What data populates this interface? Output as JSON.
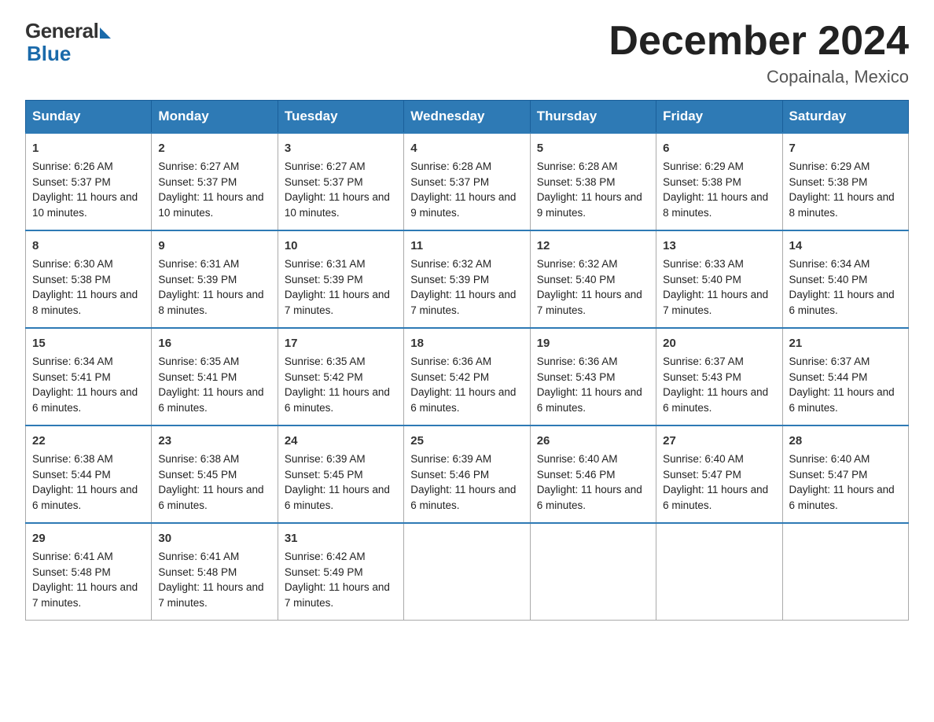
{
  "header": {
    "logo_general": "General",
    "logo_blue": "Blue",
    "month_title": "December 2024",
    "location": "Copainala, Mexico"
  },
  "days_of_week": [
    "Sunday",
    "Monday",
    "Tuesday",
    "Wednesday",
    "Thursday",
    "Friday",
    "Saturday"
  ],
  "weeks": [
    [
      {
        "day": "1",
        "sunrise": "6:26 AM",
        "sunset": "5:37 PM",
        "daylight": "11 hours and 10 minutes."
      },
      {
        "day": "2",
        "sunrise": "6:27 AM",
        "sunset": "5:37 PM",
        "daylight": "11 hours and 10 minutes."
      },
      {
        "day": "3",
        "sunrise": "6:27 AM",
        "sunset": "5:37 PM",
        "daylight": "11 hours and 10 minutes."
      },
      {
        "day": "4",
        "sunrise": "6:28 AM",
        "sunset": "5:37 PM",
        "daylight": "11 hours and 9 minutes."
      },
      {
        "day": "5",
        "sunrise": "6:28 AM",
        "sunset": "5:38 PM",
        "daylight": "11 hours and 9 minutes."
      },
      {
        "day": "6",
        "sunrise": "6:29 AM",
        "sunset": "5:38 PM",
        "daylight": "11 hours and 8 minutes."
      },
      {
        "day": "7",
        "sunrise": "6:29 AM",
        "sunset": "5:38 PM",
        "daylight": "11 hours and 8 minutes."
      }
    ],
    [
      {
        "day": "8",
        "sunrise": "6:30 AM",
        "sunset": "5:38 PM",
        "daylight": "11 hours and 8 minutes."
      },
      {
        "day": "9",
        "sunrise": "6:31 AM",
        "sunset": "5:39 PM",
        "daylight": "11 hours and 8 minutes."
      },
      {
        "day": "10",
        "sunrise": "6:31 AM",
        "sunset": "5:39 PM",
        "daylight": "11 hours and 7 minutes."
      },
      {
        "day": "11",
        "sunrise": "6:32 AM",
        "sunset": "5:39 PM",
        "daylight": "11 hours and 7 minutes."
      },
      {
        "day": "12",
        "sunrise": "6:32 AM",
        "sunset": "5:40 PM",
        "daylight": "11 hours and 7 minutes."
      },
      {
        "day": "13",
        "sunrise": "6:33 AM",
        "sunset": "5:40 PM",
        "daylight": "11 hours and 7 minutes."
      },
      {
        "day": "14",
        "sunrise": "6:34 AM",
        "sunset": "5:40 PM",
        "daylight": "11 hours and 6 minutes."
      }
    ],
    [
      {
        "day": "15",
        "sunrise": "6:34 AM",
        "sunset": "5:41 PM",
        "daylight": "11 hours and 6 minutes."
      },
      {
        "day": "16",
        "sunrise": "6:35 AM",
        "sunset": "5:41 PM",
        "daylight": "11 hours and 6 minutes."
      },
      {
        "day": "17",
        "sunrise": "6:35 AM",
        "sunset": "5:42 PM",
        "daylight": "11 hours and 6 minutes."
      },
      {
        "day": "18",
        "sunrise": "6:36 AM",
        "sunset": "5:42 PM",
        "daylight": "11 hours and 6 minutes."
      },
      {
        "day": "19",
        "sunrise": "6:36 AM",
        "sunset": "5:43 PM",
        "daylight": "11 hours and 6 minutes."
      },
      {
        "day": "20",
        "sunrise": "6:37 AM",
        "sunset": "5:43 PM",
        "daylight": "11 hours and 6 minutes."
      },
      {
        "day": "21",
        "sunrise": "6:37 AM",
        "sunset": "5:44 PM",
        "daylight": "11 hours and 6 minutes."
      }
    ],
    [
      {
        "day": "22",
        "sunrise": "6:38 AM",
        "sunset": "5:44 PM",
        "daylight": "11 hours and 6 minutes."
      },
      {
        "day": "23",
        "sunrise": "6:38 AM",
        "sunset": "5:45 PM",
        "daylight": "11 hours and 6 minutes."
      },
      {
        "day": "24",
        "sunrise": "6:39 AM",
        "sunset": "5:45 PM",
        "daylight": "11 hours and 6 minutes."
      },
      {
        "day": "25",
        "sunrise": "6:39 AM",
        "sunset": "5:46 PM",
        "daylight": "11 hours and 6 minutes."
      },
      {
        "day": "26",
        "sunrise": "6:40 AM",
        "sunset": "5:46 PM",
        "daylight": "11 hours and 6 minutes."
      },
      {
        "day": "27",
        "sunrise": "6:40 AM",
        "sunset": "5:47 PM",
        "daylight": "11 hours and 6 minutes."
      },
      {
        "day": "28",
        "sunrise": "6:40 AM",
        "sunset": "5:47 PM",
        "daylight": "11 hours and 6 minutes."
      }
    ],
    [
      {
        "day": "29",
        "sunrise": "6:41 AM",
        "sunset": "5:48 PM",
        "daylight": "11 hours and 7 minutes."
      },
      {
        "day": "30",
        "sunrise": "6:41 AM",
        "sunset": "5:48 PM",
        "daylight": "11 hours and 7 minutes."
      },
      {
        "day": "31",
        "sunrise": "6:42 AM",
        "sunset": "5:49 PM",
        "daylight": "11 hours and 7 minutes."
      },
      null,
      null,
      null,
      null
    ]
  ]
}
